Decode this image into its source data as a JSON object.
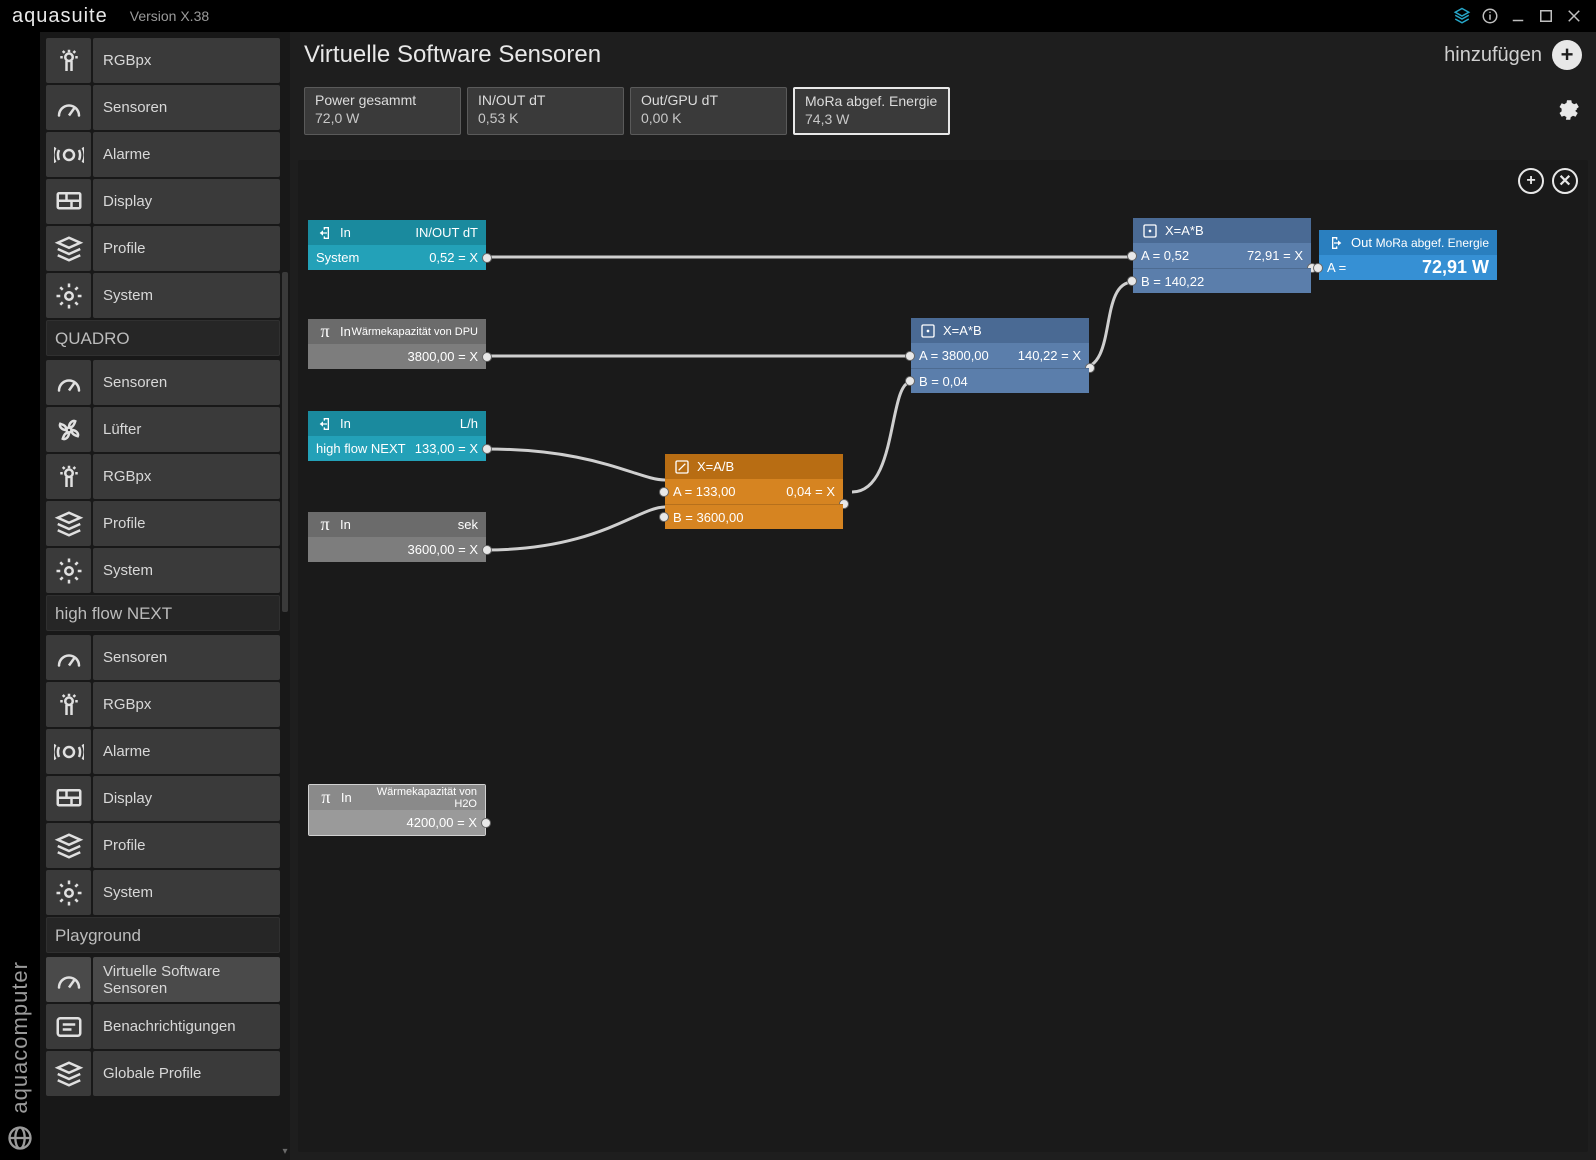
{
  "app": {
    "name": "aquasuite",
    "version": "Version X.38",
    "leftBrand": "aquacomputer"
  },
  "titlebarIcons": [
    "layers",
    "info",
    "minimize",
    "maximize",
    "close"
  ],
  "sidebar": {
    "groups": [
      {
        "header": null,
        "items": [
          {
            "icon": "rgb",
            "label": "RGBpx"
          },
          {
            "icon": "gauge",
            "label": "Sensoren"
          },
          {
            "icon": "alarm",
            "label": "Alarme"
          },
          {
            "icon": "display",
            "label": "Display"
          },
          {
            "icon": "stack",
            "label": "Profile"
          },
          {
            "icon": "gear",
            "label": "System"
          }
        ]
      },
      {
        "header": "QUADRO",
        "items": [
          {
            "icon": "gauge",
            "label": "Sensoren"
          },
          {
            "icon": "fan",
            "label": "Lüfter"
          },
          {
            "icon": "rgb",
            "label": "RGBpx"
          },
          {
            "icon": "stack",
            "label": "Profile"
          },
          {
            "icon": "gear",
            "label": "System"
          }
        ]
      },
      {
        "header": "high flow NEXT",
        "items": [
          {
            "icon": "gauge",
            "label": "Sensoren"
          },
          {
            "icon": "rgb",
            "label": "RGBpx"
          },
          {
            "icon": "alarm",
            "label": "Alarme"
          },
          {
            "icon": "display",
            "label": "Display"
          },
          {
            "icon": "stack",
            "label": "Profile"
          },
          {
            "icon": "gear",
            "label": "System"
          }
        ]
      },
      {
        "header": "Playground",
        "items": [
          {
            "icon": "gauge",
            "label": "Virtuelle Software Sensoren",
            "active": true
          },
          {
            "icon": "msg",
            "label": "Benachrichtigungen"
          },
          {
            "icon": "stack",
            "label": "Globale Profile"
          }
        ]
      }
    ]
  },
  "page": {
    "title": "Virtuelle Software Sensoren",
    "addLabel": "hinzufügen"
  },
  "sensorCards": [
    {
      "title": "Power gesammt",
      "value": "72,0 W"
    },
    {
      "title": "IN/OUT dT",
      "value": "0,53 K"
    },
    {
      "title": "Out/GPU dT",
      "value": "0,00 K"
    },
    {
      "title": "MoRa abgef. Energie",
      "value": "74,3 W",
      "selected": true
    }
  ],
  "nodes": {
    "in1": {
      "hdrL": "In",
      "hdrR": "IN/OUT dT",
      "bodyL": "System",
      "bodyR": "0,52  =  X"
    },
    "in2": {
      "hdrL": "In",
      "hdrR": "Wärmekapazität von DPU",
      "bodyR": "3800,00  =  X"
    },
    "in3": {
      "hdrL": "In",
      "hdrR": "L/h",
      "bodyL": "high flow NEXT",
      "bodyR": "133,00  =  X"
    },
    "in4": {
      "hdrL": "In",
      "hdrR": "sek",
      "bodyR": "3600,00  =  X"
    },
    "in5": {
      "hdrL": "In",
      "hdrR": "Wärmekapazität von H2O",
      "bodyR": "4200,00  =  X"
    },
    "div": {
      "hdr": "X=A/B",
      "a": "A =  133,00",
      "b": "B =  3600,00",
      "out": "0,04  =  X"
    },
    "mul1": {
      "hdr": "X=A*B",
      "a": "A =  3800,00",
      "b": "B =  0,04",
      "out": "140,22  =  X"
    },
    "mul2": {
      "hdr": "X=A*B",
      "a": "A =  0,52",
      "b": "B =  140,22",
      "out": "72,91  =  X"
    },
    "out": {
      "hdrL": "Out",
      "hdrR": "MoRa abgef. Energie",
      "a": "A =",
      "val": "72,91 W"
    }
  }
}
